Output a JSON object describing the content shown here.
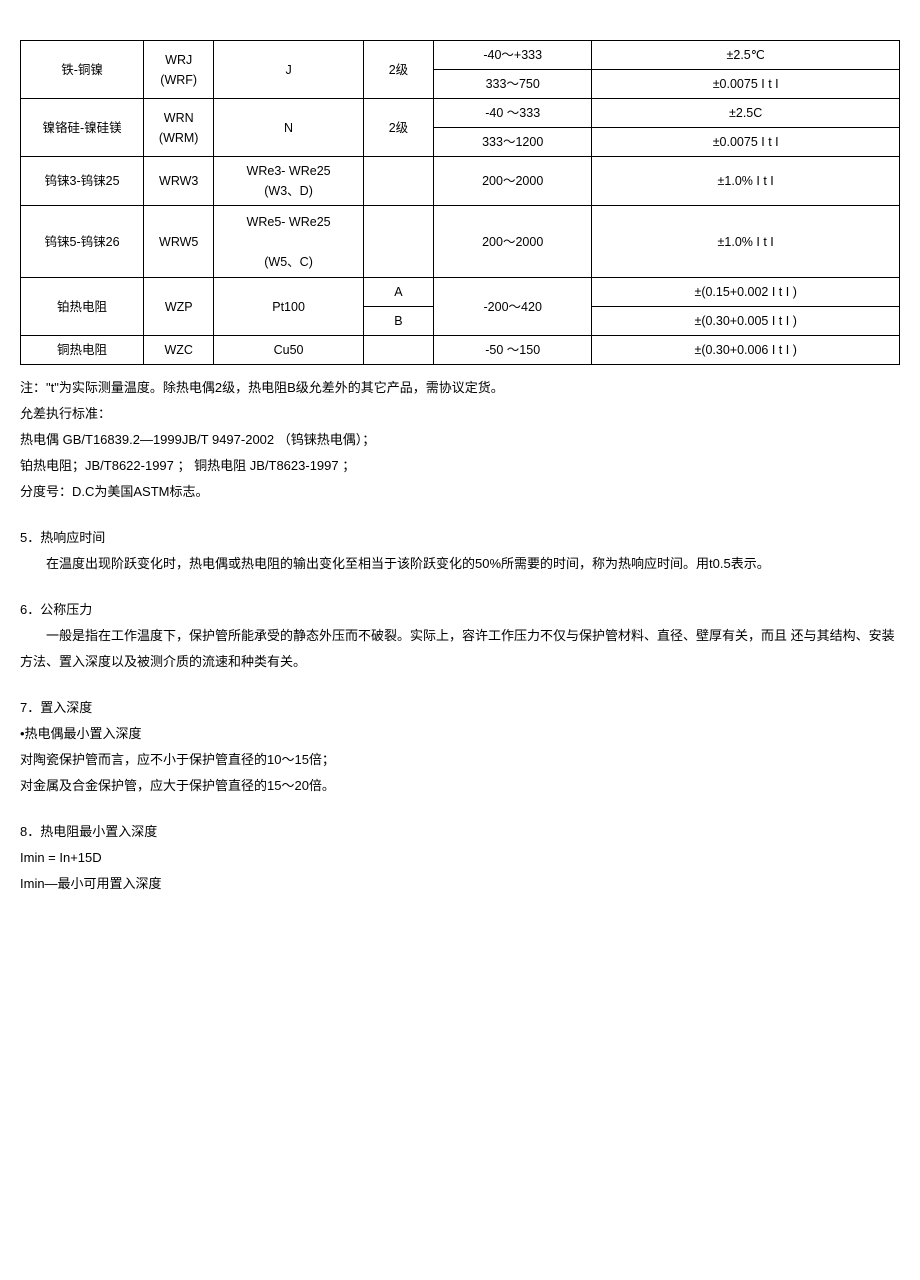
{
  "table": {
    "rows": [
      {
        "c0": "铁-铜镍",
        "c1": "WRJ\n(WRF)",
        "c2": "J",
        "c3": "2级",
        "c4a": "-40～+333",
        "c4b": "333～750",
        "c5a": "±2.5℃",
        "c5b": "±0.0075 I  t I"
      },
      {
        "c0": "镍铬硅-镍硅镁",
        "c1": "WRN\n(WRM)",
        "c2": "N",
        "c3": "2级",
        "c4a": "-40 ～333",
        "c4b": "333～1200",
        "c5a": "±2.5C",
        "c5b": "±0.0075 I  t I"
      },
      {
        "c0": "钨铼3-钨铼25",
        "c1": "WRW3",
        "c2": "WRe3- WRe25\n(W3、D)",
        "c3": "",
        "c4": "200～2000",
        "c5": "±1.0% I  t I"
      },
      {
        "c0": "钨铼5-钨铼26",
        "c1": "WRW5",
        "c2": "WRe5- WRe25\n\n(W5、C)",
        "c3": "",
        "c4": "200～2000",
        "c5": "±1.0% I  t I"
      },
      {
        "c0": "铂热电阻",
        "c1": "WZP",
        "c2": "Pt100",
        "c3a": "A",
        "c3b": "B",
        "c4": "-200～420",
        "c5a": "±(0.15+0.002 I  t I   )",
        "c5b": "±(0.30+0.005 I  t I   )"
      },
      {
        "c0": "铜热电阻",
        "c1": "WZC",
        "c2": "Cu50",
        "c3": "",
        "c4": "-50 ～150",
        "c5": "±(0.30+0.006 I  t I   )"
      }
    ]
  },
  "notes": {
    "n1": "注：\"t\"为实际测量温度。除热电偶2级，热电阻B级允差外的其它产品，需协议定货。",
    "n2": "允差执行标准：",
    "n3": "热电偶  GB/T16839.2—1999JB/T 9497-2002 （钨铼热电偶）；",
    "n4": "铂热电阻；JB/T8622-1997 ；   铜热电阻  JB/T8623-1997 ；",
    "n5": "分度号：D.C为美国ASTM标志。"
  },
  "sections": {
    "s5_title": "5．热响应时间",
    "s5_body": "在温度出现阶跃变化时，热电偶或热电阻的输出变化至相当于该阶跃变化的50%所需要的时间，称为热响应时间。用t0.5表示。",
    "s6_title": "6．公称压力",
    "s6_body": "一般是指在工作温度下，保护管所能承受的静态外压而不破裂。实际上，容许工作压力不仅与保护管材料、直径、壁厚有关，而且 还与其结构、安装方法、置入深度以及被测介质的流速和种类有关。",
    "s7_title": "7．置入深度",
    "s7_sub": "•热电偶最小置入深度",
    "s7_l1": "对陶瓷保护管而言，应不小于保护管直径的10～15倍；",
    "s7_l2": "对金属及合金保护管，应大于保护管直径的15～20倍。",
    "s8_title": "8．热电阻最小置入深度",
    "s8_l1": "Imin = In+15D",
    "s8_l2": "Imin—最小可用置入深度"
  }
}
